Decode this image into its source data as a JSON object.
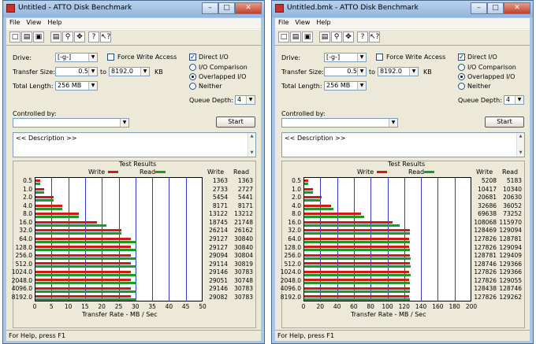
{
  "windows": [
    {
      "title": "Untitled - ATTO Disk Benchmark",
      "menu": [
        "File",
        "View",
        "Help"
      ],
      "drive_label": "Drive:",
      "drive_value": "[-g-]",
      "transfer_size_label": "Transfer Size:",
      "transfer_from": "0.5",
      "to_label": "to",
      "transfer_to": "8192.0",
      "kb_label": "KB",
      "total_length_label": "Total Length:",
      "total_length_value": "256 MB",
      "force_write_label": "Force Write Access",
      "force_write_checked": false,
      "direct_io_label": "Direct I/O",
      "direct_io_checked": true,
      "radio_options": [
        "I/O Comparison",
        "Overlapped I/O",
        "Neither"
      ],
      "radio_selected": 1,
      "queue_depth_label": "Queue Depth:",
      "queue_depth_value": "4",
      "controlled_by_label": "Controlled by:",
      "controlled_by_value": "",
      "start_label": "Start",
      "description_text": "<< Description >>",
      "test_results_label": "Test Results",
      "legend_write": "Write",
      "legend_read": "Read",
      "col_write": "Write",
      "col_read": "Read",
      "status_text": "For Help, press F1",
      "chart_data": {
        "type": "bar",
        "orientation": "horizontal",
        "title": "Test Results",
        "xlabel": "Transfer Rate - MB / Sec",
        "xlim": [
          0,
          50
        ],
        "x_ticks": [
          "0",
          "5",
          "10",
          "15",
          "20",
          "25",
          "30",
          "35",
          "40",
          "45",
          "50"
        ],
        "categories": [
          "0.5",
          "1.0",
          "2.0",
          "4.0",
          "8.0",
          "16.0",
          "32.0",
          "64.0",
          "128.0",
          "256.0",
          "512.0",
          "1024.0",
          "2048.0",
          "4096.0",
          "8192.0"
        ],
        "series": [
          {
            "name": "Write",
            "color": "#d21818",
            "values": [
              1363,
              2733,
              5454,
              8171,
              13122,
              18745,
              26214,
              29127,
              29127,
              29094,
              29114,
              29146,
              29051,
              29146,
              29082
            ]
          },
          {
            "name": "Read",
            "color": "#1a9a2a",
            "values": [
              1363,
              2727,
              5441,
              8171,
              13212,
              21748,
              26162,
              30840,
              30840,
              30804,
              30819,
              30783,
              30748,
              30783,
              30783
            ]
          }
        ],
        "value_units": "KB/s"
      }
    },
    {
      "title": "Untitled.bmk - ATTO Disk Benchmark",
      "menu": [
        "File",
        "View",
        "Help"
      ],
      "drive_label": "Drive:",
      "drive_value": "[-g-]",
      "transfer_size_label": "Transfer Size:",
      "transfer_from": "0.5",
      "to_label": "to",
      "transfer_to": "8192.0",
      "kb_label": "KB",
      "total_length_label": "Total Length:",
      "total_length_value": "256 MB",
      "force_write_label": "Force Write Access",
      "force_write_checked": false,
      "direct_io_label": "Direct I/O",
      "direct_io_checked": true,
      "radio_options": [
        "I/O Comparison",
        "Overlapped I/O",
        "Neither"
      ],
      "radio_selected": 1,
      "queue_depth_label": "Queue Depth:",
      "queue_depth_value": "4",
      "controlled_by_label": "Controlled by:",
      "controlled_by_value": "",
      "start_label": "Start",
      "description_text": "<< Description >>",
      "test_results_label": "Test Results",
      "legend_write": "Write",
      "legend_read": "Read",
      "col_write": "Write",
      "col_read": "Read",
      "status_text": "For Help, press F1",
      "chart_data": {
        "type": "bar",
        "orientation": "horizontal",
        "title": "Test Results",
        "xlabel": "Transfer Rate - MB / Sec",
        "xlim": [
          0,
          200
        ],
        "x_ticks": [
          "0",
          "20",
          "40",
          "60",
          "80",
          "100",
          "120",
          "140",
          "160",
          "180",
          "200"
        ],
        "categories": [
          "0.5",
          "1.0",
          "2.0",
          "4.0",
          "8.0",
          "16.0",
          "32.0",
          "64.0",
          "128.0",
          "256.0",
          "512.0",
          "1024.0",
          "2048.0",
          "4096.0",
          "8192.0"
        ],
        "series": [
          {
            "name": "Write",
            "color": "#d21818",
            "values": [
              5208,
              10417,
              20681,
              32686,
              69638,
              108068,
              128469,
              127826,
              127826,
              128781,
              128746,
              127826,
              127826,
              128438,
              127826
            ]
          },
          {
            "name": "Read",
            "color": "#1a9a2a",
            "values": [
              5183,
              10340,
              20630,
              36052,
              73252,
              115970,
              129094,
              128781,
              129094,
              129409,
              129366,
              129366,
              129055,
              128746,
              129262
            ]
          }
        ],
        "value_units": "KB/s"
      }
    }
  ],
  "toolbar_icons": [
    "new-icon",
    "open-icon",
    "save-icon",
    "print-icon",
    "print-preview-icon",
    "move-icon",
    "about-icon",
    "context-help-icon"
  ]
}
